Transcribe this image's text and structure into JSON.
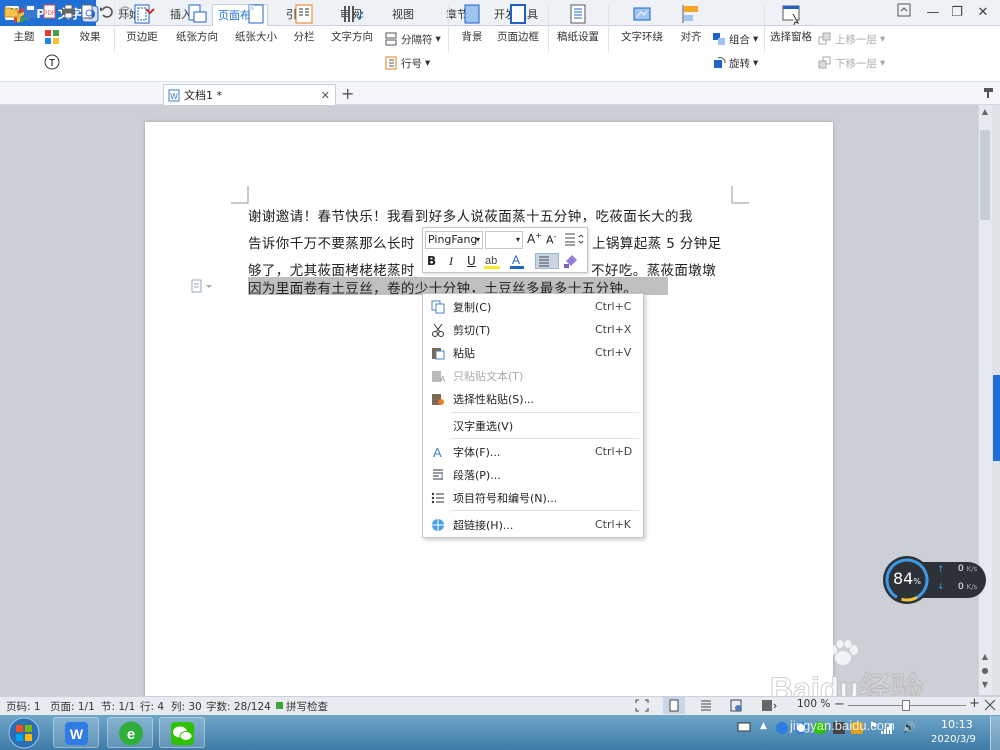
{
  "app": {
    "name": "WPS 文字"
  },
  "menu_tabs": [
    "开始",
    "插入",
    "页面布局",
    "引用",
    "审阅",
    "视图",
    "章节",
    "开发工具"
  ],
  "active_tab": "页面布局",
  "ribbon": {
    "theme": "主题",
    "effects": "效果",
    "margins": "页边距",
    "orientation": "纸张方向",
    "size": "纸张大小",
    "columns": "分栏",
    "text_direction": "文字方向",
    "breaks": "分隔符",
    "line_numbers": "行号",
    "background": "背景",
    "page_border": "页面边框",
    "manuscript": "稿纸设置",
    "wrap_text": "文字环绕",
    "align": "对齐",
    "group": "组合",
    "rotate": "旋转",
    "selection_pane": "选择窗格",
    "bring_forward": "上移一层",
    "send_backward": "下移一层"
  },
  "document_tab": {
    "name": "文档1 *"
  },
  "document": {
    "lines": [
      "谢谢邀请！春节快乐！我看到好多人说莜面蒸十五分钟，吃莜面长大的我",
      "告诉你千万不要蒸那么长时",
      "上锅算起蒸 5 分钟足",
      "够了，尤其莜面栲栳栳蒸时",
      "不好吃。蒸莜面墩墩",
      "因为里面卷有土豆丝，卷的少十分钟，土豆丝多最多十五分钟。"
    ]
  },
  "mini_toolbar": {
    "font": "PingFang",
    "size": ""
  },
  "context_menu": {
    "items": [
      {
        "label": "复制(C)",
        "shortcut": "Ctrl+C",
        "icon": "copy-icon",
        "enabled": true
      },
      {
        "label": "剪切(T)",
        "shortcut": "Ctrl+X",
        "icon": "cut-icon",
        "enabled": true
      },
      {
        "label": "粘贴",
        "shortcut": "Ctrl+V",
        "icon": "paste-icon",
        "enabled": true
      },
      {
        "label": "只粘贴文本(T)",
        "shortcut": "",
        "icon": "paste-text-icon",
        "enabled": false
      },
      {
        "label": "选择性粘贴(S)...",
        "shortcut": "",
        "icon": "paste-special-icon",
        "enabled": true
      },
      {
        "label": "汉字重选(V)",
        "shortcut": "",
        "icon": "",
        "enabled": true
      },
      {
        "label": "字体(F)...",
        "shortcut": "Ctrl+D",
        "icon": "font-icon",
        "enabled": true
      },
      {
        "label": "段落(P)...",
        "shortcut": "",
        "icon": "paragraph-icon",
        "enabled": true
      },
      {
        "label": "项目符号和编号(N)...",
        "shortcut": "",
        "icon": "bullets-icon",
        "enabled": true
      },
      {
        "label": "超链接(H)...",
        "shortcut": "Ctrl+K",
        "icon": "hyperlink-icon",
        "enabled": true
      }
    ]
  },
  "status": {
    "page_num": "页码: 1",
    "pages": "页面: 1/1",
    "section": "节: 1/1",
    "row": "行: 4",
    "col": "列: 30",
    "words": "字数: 28/124",
    "spell": "拼写检查",
    "zoom": "100 %"
  },
  "speed_widget": {
    "percent": "84",
    "unit": "%",
    "up": "0",
    "down": "0",
    "rate_unit": "K/s"
  },
  "watermark": {
    "brand": "Baidu经验",
    "url": "jingyan.baidu.com"
  },
  "taskbar": {
    "time": "10:13",
    "date": "2020/3/9"
  }
}
